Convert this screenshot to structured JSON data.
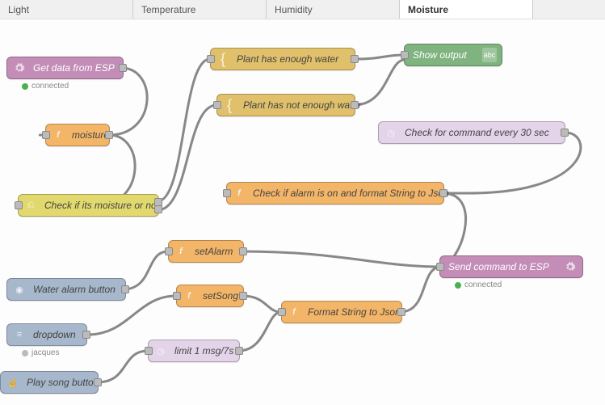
{
  "tabs": [
    {
      "label": "Light",
      "active": false
    },
    {
      "label": "Temperature",
      "active": false
    },
    {
      "label": "Humidity",
      "active": false
    },
    {
      "label": "Moisture",
      "active": true
    }
  ],
  "nodes": {
    "get_data": {
      "label": "Get data from ESP",
      "status": "connected",
      "status_color": "green"
    },
    "moisture": {
      "label": "moisture"
    },
    "switch_moisture": {
      "label": "Check if its moisture or not"
    },
    "template_enough": {
      "label": "Plant has enough water"
    },
    "template_not_enough": {
      "label": "Plant has not enough water"
    },
    "show_output": {
      "label": "Show output",
      "badge": "abc"
    },
    "check_command": {
      "label": "Check for command every 30 sec"
    },
    "fn_alarm_json": {
      "label": "Check if alarm is on and format String to Json"
    },
    "water_alarm": {
      "label": "Water alarm button"
    },
    "dropdown": {
      "label": "dropdown",
      "status": "jacques",
      "status_color": "grey"
    },
    "play_song": {
      "label": "Play song button"
    },
    "set_alarm": {
      "label": "setAlarm"
    },
    "set_song": {
      "label": "setSong"
    },
    "limit_msg": {
      "label": "limit 1 msg/7s"
    },
    "format_json": {
      "label": "Format String to Json"
    },
    "send_command": {
      "label": "Send command to ESP",
      "status": "connected",
      "status_color": "green"
    }
  },
  "icons": {
    "gear": "gear-icon",
    "function": "function-icon",
    "switch": "switch-icon",
    "template": "template-icon",
    "timer": "timer-icon",
    "slider": "slider-icon",
    "list": "list-icon",
    "hand": "hand-icon"
  }
}
